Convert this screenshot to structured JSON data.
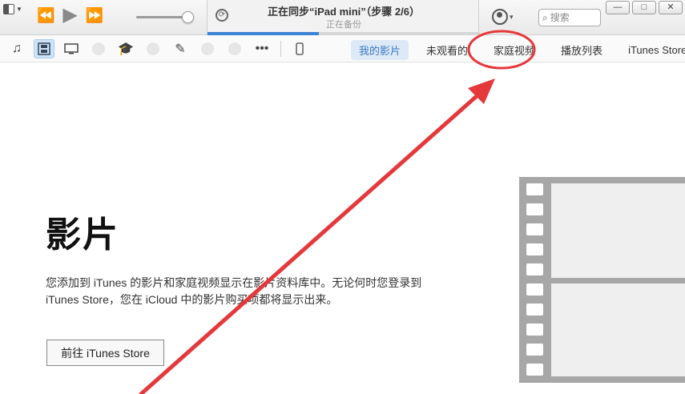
{
  "titlebar": {
    "sync_title": "正在同步“iPad mini”（步骤 2/6）",
    "sync_subtitle": "正在备份",
    "sync_progress": 0.41,
    "search_placeholder": "搜索",
    "search_icon": "magnifier-icon",
    "window_buttons": [
      "—",
      "□",
      "✕"
    ],
    "transport_icons": [
      "rewind-icon",
      "play-icon",
      "fast-forward-icon"
    ],
    "volume_level": 0.85
  },
  "nav": {
    "media_icons": [
      "music-icon",
      "movie-icon",
      "tv-icon",
      "podcast-icon",
      "itunes-u-icon",
      "audiobook-icon",
      "ringtone-icon",
      "app-icon",
      "radio-icon",
      "more-icon",
      "device-icon"
    ],
    "tabs": [
      {
        "label": "我的影片",
        "active": true
      },
      {
        "label": "未观看的",
        "active": false
      },
      {
        "label": "家庭视频",
        "active": false
      },
      {
        "label": "播放列表",
        "active": false
      },
      {
        "label": "iTunes Store",
        "active": false
      }
    ]
  },
  "main": {
    "title": "影片",
    "description": "您添加到 iTunes 的影片和家庭视频显示在影片资料库中。无论何时您登录到 iTunes Store，您在 iCloud 中的影片购买项都将显示出来。",
    "goto_button": "前往 iTunes Store"
  },
  "colors": {
    "accent": "#3b83d6",
    "active_tab_bg": "#dde9f6",
    "annotation": "#e5383b",
    "film_strip": "#a7a7a7"
  }
}
